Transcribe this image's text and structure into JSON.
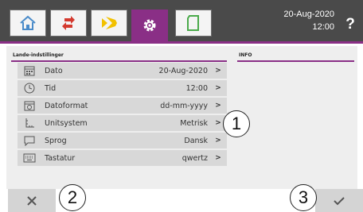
{
  "topbar": {
    "tabs": [
      {
        "icon": "home-icon",
        "color": "#4a8bc9"
      },
      {
        "icon": "swap-arrows-icon",
        "color": "#d43a2f"
      },
      {
        "icon": "light-icon",
        "color": "#f2c100"
      },
      {
        "icon": "gear-icon",
        "active": true,
        "color": "#8a2f86"
      },
      {
        "icon": "card-icon",
        "color": "#4aaa4a"
      }
    ],
    "date": "20-Aug-2020",
    "time": "12:00",
    "help": "?"
  },
  "left_section": {
    "title": "Lande-indstillinger",
    "items": [
      {
        "icon": "calendar-icon",
        "label": "Dato",
        "value": "20-Aug-2020"
      },
      {
        "icon": "clock-icon",
        "label": "Tid",
        "value": "12:00"
      },
      {
        "icon": "date-format-icon",
        "label": "Datoformat",
        "value": "dd-mm-yyyy"
      },
      {
        "icon": "unit-system-icon",
        "label": "Unitsystem",
        "value": "Metrisk"
      },
      {
        "icon": "speech-bubble-icon",
        "label": "Sprog",
        "value": "Dansk"
      },
      {
        "icon": "keyboard-icon",
        "label": "Tastatur",
        "value": "qwertz"
      }
    ],
    "chevron": ">"
  },
  "right_section": {
    "title": "INFO"
  },
  "callouts": [
    "1",
    "2",
    "3"
  ],
  "bottombar": {
    "cancel_icon": "close-icon",
    "confirm_icon": "check-icon"
  }
}
